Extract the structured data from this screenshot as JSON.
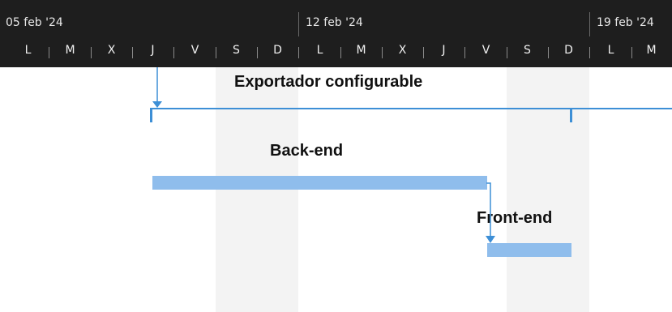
{
  "timescale": {
    "weeks": [
      {
        "label": "05 feb '24"
      },
      {
        "label": "12 feb '24"
      },
      {
        "label": "19 feb '24"
      }
    ],
    "days": [
      "L",
      "M",
      "X",
      "J",
      "V",
      "S",
      "D",
      "L",
      "M",
      "X",
      "J",
      "V",
      "S",
      "D",
      "L",
      "M"
    ]
  },
  "tasks": {
    "summary": {
      "label": "Exportador configurable"
    },
    "backend": {
      "label": "Back-end"
    },
    "frontend": {
      "label": "Front-end"
    }
  },
  "colors": {
    "header_bg": "#1e1e1e",
    "weekend_shade": "#f3f3f3",
    "task_bar": "#8fbdec",
    "summary_bar": "#3d8fd6",
    "link_arrow": "#3d8fd6"
  }
}
